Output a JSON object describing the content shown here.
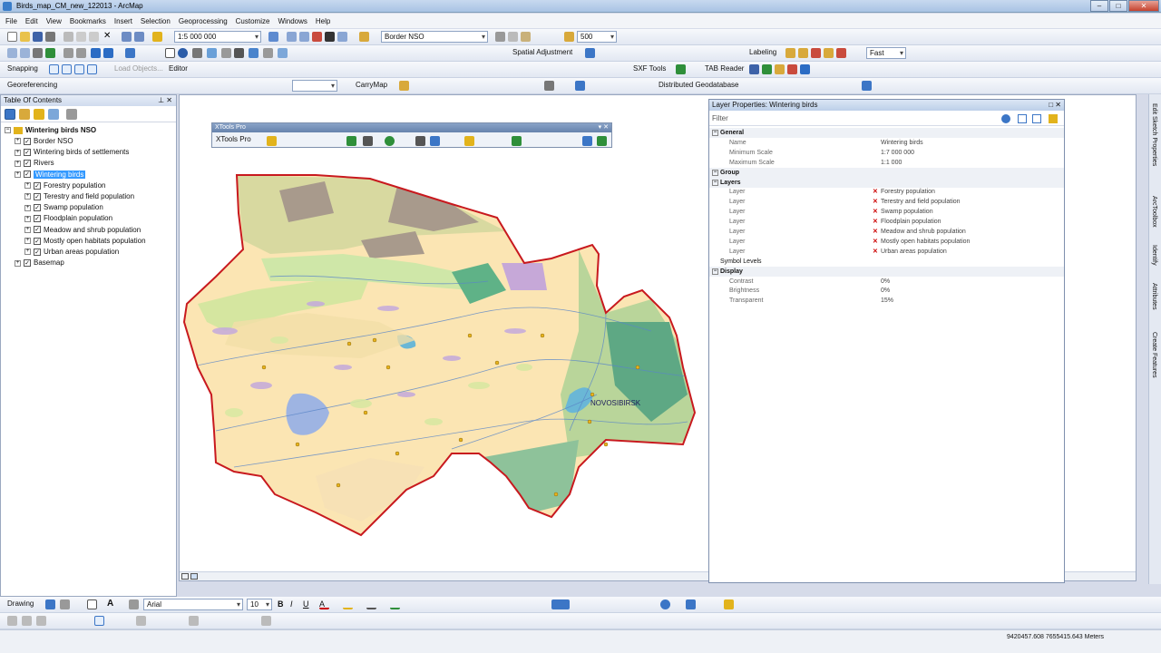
{
  "window": {
    "title": "Birds_map_CM_new_122013 - ArcMap"
  },
  "menu": [
    "File",
    "Edit",
    "View",
    "Bookmarks",
    "Insert",
    "Selection",
    "Geoprocessing",
    "Customize",
    "Windows",
    "Help"
  ],
  "toolbar": {
    "scale": "1:5 000 000",
    "layer_combo": "Border NSO",
    "zoom_value": "500",
    "spatial_adjustment": "Spatial Adjustment",
    "labeling": "Labeling",
    "label_speed": "Fast",
    "snapping": "Snapping",
    "load_objects": "Load Objects...",
    "editor": "Editor",
    "sxf_tools": "SXF Tools",
    "tab_reader": "TAB Reader",
    "georeferencing": "Georeferencing",
    "carrymap": "CarryMap",
    "distributed_geodatabase": "Distributed Geodatabase"
  },
  "toc": {
    "title": "Table Of Contents",
    "root": "Wintering birds NSO",
    "layers": [
      {
        "label": "Border NSO",
        "indent": 1
      },
      {
        "label": "Wintering birds of settlements",
        "indent": 1
      },
      {
        "label": "Rivers",
        "indent": 1
      },
      {
        "label": "Wintering birds",
        "indent": 1,
        "selected": true
      },
      {
        "label": "Forestry population",
        "indent": 2
      },
      {
        "label": "Terestry and field population",
        "indent": 2
      },
      {
        "label": "Swamp population",
        "indent": 2
      },
      {
        "label": "Floodplain population",
        "indent": 2
      },
      {
        "label": "Meadow and shrub population",
        "indent": 2
      },
      {
        "label": "Mostly open habitats population",
        "indent": 2
      },
      {
        "label": "Urban areas population",
        "indent": 2
      },
      {
        "label": "Basemap",
        "indent": 1
      }
    ]
  },
  "xtools": {
    "title": "XTools Pro",
    "menu_label": "XTools Pro"
  },
  "map": {
    "city_label": "NOVOSIBIRSK"
  },
  "layer_properties": {
    "title": "Layer Properties: Wintering birds",
    "filter_placeholder": "Filter",
    "general": "General",
    "name_key": "Name",
    "name_val": "Wintering birds",
    "min_scale_key": "Minimum Scale",
    "min_scale_val": "1:7 000 000",
    "max_scale_key": "Maximum Scale",
    "max_scale_val": "1:1 000",
    "group": "Group",
    "layers": "Layers",
    "layer_key": "Layer",
    "layer_values": [
      "Forestry population",
      "Terestry and field population",
      "Swamp population",
      "Floodplain population",
      "Meadow and shrub population",
      "Mostly open habitats population",
      "Urban areas population"
    ],
    "symbol_levels": "Symbol Levels",
    "display": "Display",
    "contrast_key": "Contrast",
    "contrast_val": "0%",
    "brightness_key": "Brightness",
    "brightness_val": "0%",
    "transparent_key": "Transparent",
    "transparent_val": "15%"
  },
  "side_tabs": [
    "Edit Sketch Properties",
    "ArcToolbox",
    "Identify",
    "Attributes",
    "Create Features"
  ],
  "drawing": {
    "label": "Drawing",
    "font": "Arial",
    "size": "10"
  },
  "status": {
    "coords": "9420457.608  7655415.643 Meters"
  }
}
